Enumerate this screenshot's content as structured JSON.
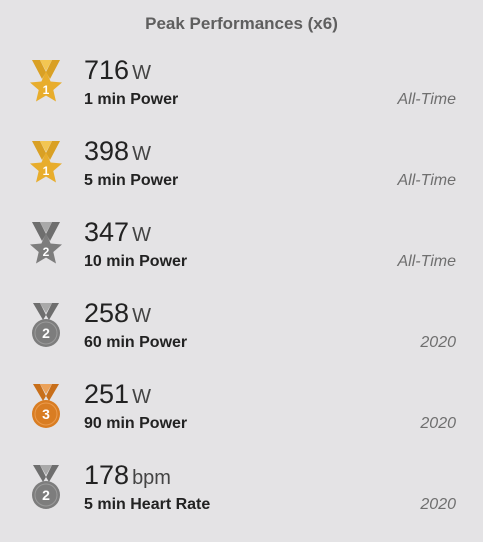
{
  "panel": {
    "title": "Peak Performances (x6)"
  },
  "colors": {
    "gold": "#e8ad2c",
    "gold_ribbon": "#d9a024",
    "silver": "#7d7d7d",
    "silver_ribbon": "#6e6e6e",
    "bronze": "#d97d22",
    "bronze_ribbon": "#c86f1a",
    "background": "#e4e3e5"
  },
  "rows": [
    {
      "rank": "1",
      "medal_icon": "gold-star-medal-icon",
      "value": "716",
      "unit": "W",
      "label": "1 min Power",
      "period": "All-Time"
    },
    {
      "rank": "1",
      "medal_icon": "gold-star-medal-icon",
      "value": "398",
      "unit": "W",
      "label": "5 min Power",
      "period": "All-Time"
    },
    {
      "rank": "2",
      "medal_icon": "silver-star-medal-icon",
      "value": "347",
      "unit": "W",
      "label": "10 min Power",
      "period": "All-Time"
    },
    {
      "rank": "2",
      "medal_icon": "silver-circle-medal-icon",
      "value": "258",
      "unit": "W",
      "label": "60 min Power",
      "period": "2020"
    },
    {
      "rank": "3",
      "medal_icon": "bronze-circle-medal-icon",
      "value": "251",
      "unit": "W",
      "label": "90 min Power",
      "period": "2020"
    },
    {
      "rank": "2",
      "medal_icon": "silver-circle-medal-icon",
      "value": "178",
      "unit": "bpm",
      "label": "5 min Heart Rate",
      "period": "2020"
    }
  ]
}
